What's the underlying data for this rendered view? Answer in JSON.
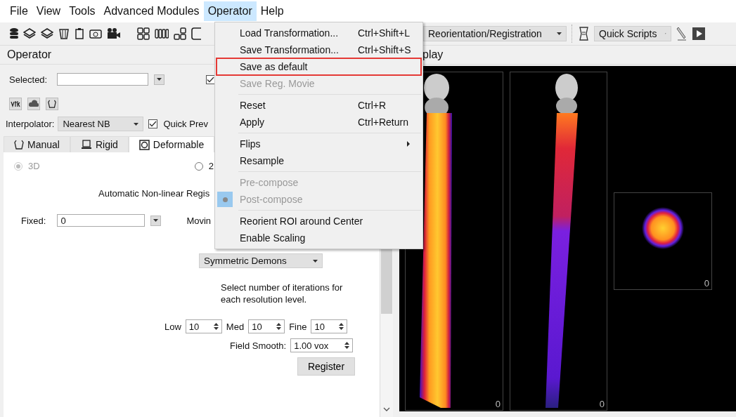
{
  "menubar": [
    {
      "label": "File",
      "selected": false
    },
    {
      "label": "View",
      "selected": false
    },
    {
      "label": "Tools",
      "selected": false
    },
    {
      "label": "Advanced Modules",
      "selected": false
    },
    {
      "label": "Operator",
      "selected": true
    },
    {
      "label": "Help",
      "selected": false
    }
  ],
  "toolbar": {
    "module_select": "Reorientation/Registration",
    "script_select": "Quick Scripts"
  },
  "operator_panel": {
    "title": "Operator",
    "selected_label": "Selected:",
    "top_checkbox_checked": true,
    "interpolator_label": "Interpolator:",
    "interpolator": "Nearest NB",
    "quick_preview": {
      "label": "Quick Prev",
      "checked": true
    },
    "tabs": [
      {
        "label": "Manual",
        "kind": "manual",
        "selected": false
      },
      {
        "label": "Rigid",
        "kind": "rigid",
        "selected": false
      },
      {
        "label": "Deformable",
        "kind": "deformable",
        "selected": true
      }
    ],
    "radios": [
      {
        "label": "3D",
        "selected": true,
        "disabled": true
      },
      {
        "label": "2",
        "selected": false,
        "disabled": false
      }
    ],
    "heading": "Automatic Non-linear Regis",
    "fixed_label": "Fixed:",
    "fixed_value": "0",
    "moving_label": "Movin",
    "method": "Symmetric Demons",
    "instructions": "Select number of iterations for each resolution level.",
    "iterations": [
      {
        "label": "Low",
        "value": "10"
      },
      {
        "label": "Med",
        "value": "10"
      },
      {
        "label": "Fine",
        "value": "10"
      }
    ],
    "smooth_label": "Field Smooth:",
    "smooth_value": "1.00 vox",
    "register_button": "Register"
  },
  "operator_menu": [
    {
      "kind": "item",
      "label": "Load Transformation...",
      "shortcut": "Ctrl+Shift+L",
      "disabled": false,
      "highlighted": false
    },
    {
      "kind": "item",
      "label": "Save Transformation...",
      "shortcut": "Ctrl+Shift+S",
      "disabled": false,
      "highlighted": false
    },
    {
      "kind": "item",
      "label": "Save as default",
      "disabled": false,
      "highlighted": true
    },
    {
      "kind": "item",
      "label": "Save Reg. Movie",
      "disabled": true,
      "highlighted": false
    },
    {
      "kind": "separator"
    },
    {
      "kind": "item",
      "label": "Reset",
      "shortcut": "Ctrl+R",
      "disabled": false,
      "highlighted": false
    },
    {
      "kind": "item",
      "label": "Apply",
      "shortcut": "Ctrl+Return",
      "disabled": false,
      "highlighted": false
    },
    {
      "kind": "separator"
    },
    {
      "kind": "submenu",
      "label": "Flips",
      "disabled": false,
      "highlighted": false
    },
    {
      "kind": "item",
      "label": "Resample",
      "disabled": false,
      "highlighted": false
    },
    {
      "kind": "separator"
    },
    {
      "kind": "check",
      "label": "Pre-compose",
      "checked": false,
      "disabled": true,
      "highlighted": false
    },
    {
      "kind": "check",
      "label": "Post-compose",
      "checked": true,
      "disabled": true,
      "highlighted": false
    },
    {
      "kind": "separator"
    },
    {
      "kind": "item",
      "label": "Reorient ROI around Center",
      "disabled": false,
      "highlighted": false
    },
    {
      "kind": "item",
      "label": "Enable Scaling",
      "disabled": false,
      "highlighted": false
    }
  ],
  "display": {
    "title": "play",
    "viewports": [
      {
        "kind": "coronal",
        "label": "0"
      },
      {
        "kind": "sagittal",
        "label": "0"
      },
      {
        "kind": "axial",
        "label": "0"
      }
    ]
  }
}
